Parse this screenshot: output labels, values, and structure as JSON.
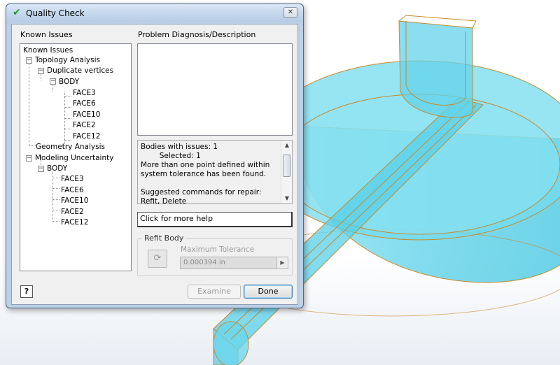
{
  "dialog": {
    "title": "Quality Check",
    "close_label": "✕",
    "known_issues_label": "Known Issues",
    "diagnosis_label": "Problem Diagnosis/Description",
    "tree": {
      "root": "Known Issues",
      "topology": "Topology Analysis",
      "duplicate_vertices": "Duplicate vertices",
      "body1": "BODY",
      "body1_faces": [
        "FACE3",
        "FACE6",
        "FACE10",
        "FACE2",
        "FACE12"
      ],
      "geometry": "Geometry Analysis",
      "modeling": "Modeling Uncertainty",
      "body2": "BODY",
      "body2_faces": [
        "FACE3",
        "FACE6",
        "FACE10",
        "FACE2",
        "FACE12"
      ]
    },
    "status_lines": [
      "Bodies with issues: 1",
      "        Selected: 1",
      "More than one point defined within",
      "system tolerance has been found.",
      "",
      "Suggested commands for repair:",
      "Refit, Delete"
    ],
    "help_button": "Click for more help",
    "refit": {
      "group_title": "Refit Body",
      "max_tolerance_label": "Maximum Tolerance",
      "tolerance_value": "0.000394 in"
    },
    "buttons": {
      "help_icon": "?",
      "examine": "Examine",
      "done": "Done"
    }
  },
  "colors": {
    "model_fill": "#62d6ec",
    "model_edge": "#c98a2a",
    "dialog_frame": "#bcd0e6",
    "check_green": "#1f9a2f"
  }
}
